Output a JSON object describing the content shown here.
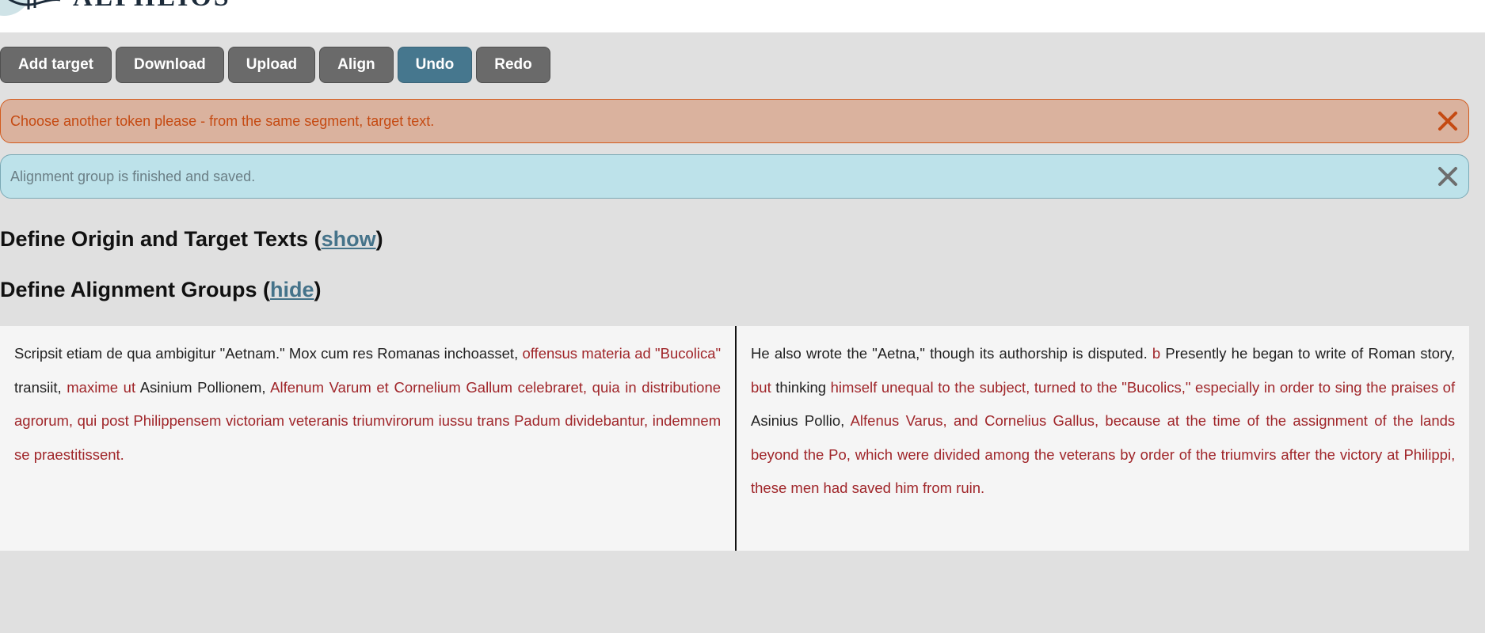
{
  "logo": {
    "text": "ALPHEIOS"
  },
  "toolbar": {
    "buttons": [
      {
        "label": "Add target",
        "active": false
      },
      {
        "label": "Download",
        "active": false
      },
      {
        "label": "Upload",
        "active": false
      },
      {
        "label": "Align",
        "active": false
      },
      {
        "label": "Undo",
        "active": true
      },
      {
        "label": "Redo",
        "active": false
      }
    ]
  },
  "alerts": {
    "error": {
      "text": "Choose another token please - from the same segment, target text.",
      "color": "#c54a12"
    },
    "info": {
      "text": "Alignment group is finished and saved."
    }
  },
  "sections": {
    "origin_target": {
      "title": "Define Origin and Target Texts (",
      "link": "show",
      "close": ")"
    },
    "alignment_groups": {
      "title": "Define Alignment Groups (",
      "link": "hide",
      "close": ")"
    }
  },
  "colors": {
    "aligned_token": "#a0262a",
    "active_button": "#46778e",
    "default_button": "#6a6a6a"
  },
  "origin_tokens": [
    {
      "t": "Scripsit",
      "a": false
    },
    {
      "t": "etiam",
      "a": false
    },
    {
      "t": "de",
      "a": false
    },
    {
      "t": "qua",
      "a": false
    },
    {
      "t": "ambigitur",
      "a": false
    },
    {
      "t": "\"Aetnam.\"",
      "a": false
    },
    {
      "t": "Mox",
      "a": false
    },
    {
      "t": "cum",
      "a": false
    },
    {
      "t": "res",
      "a": false
    },
    {
      "t": "Romanas",
      "a": false
    },
    {
      "t": "inchoasset,",
      "a": false
    },
    {
      "t": "offensus",
      "a": true
    },
    {
      "t": "materia",
      "a": true
    },
    {
      "t": "ad",
      "a": true
    },
    {
      "t": "\"Bucolica\"",
      "a": true
    },
    {
      "t": "transiit,",
      "a": false
    },
    {
      "t": "maxime",
      "a": true
    },
    {
      "t": "ut",
      "a": true
    },
    {
      "t": "Asinium",
      "a": false
    },
    {
      "t": "Pollionem,",
      "a": false
    },
    {
      "t": "Alfenum",
      "a": true
    },
    {
      "t": "Varum",
      "a": true
    },
    {
      "t": "et",
      "a": true
    },
    {
      "t": "Cornelium",
      "a": true
    },
    {
      "t": "Gallum",
      "a": true
    },
    {
      "t": "celebraret,",
      "a": true
    },
    {
      "t": "quia",
      "a": true
    },
    {
      "t": "in",
      "a": true
    },
    {
      "t": "distributione",
      "a": true
    },
    {
      "t": "agrorum,",
      "a": true
    },
    {
      "t": "qui",
      "a": true
    },
    {
      "t": "post",
      "a": true
    },
    {
      "t": "Philippensem",
      "a": true
    },
    {
      "t": "victoriam",
      "a": true
    },
    {
      "t": "veteranis",
      "a": true
    },
    {
      "t": "triumvirorum",
      "a": true
    },
    {
      "t": "iussu",
      "a": true
    },
    {
      "t": "trans",
      "a": true
    },
    {
      "t": "Padum",
      "a": true
    },
    {
      "t": "dividebantur,",
      "a": true
    },
    {
      "t": "indemnem",
      "a": true
    },
    {
      "t": "se",
      "a": true
    },
    {
      "t": "praestitissent.",
      "a": true
    }
  ],
  "target_tokens": [
    {
      "t": "He",
      "a": false
    },
    {
      "t": "also",
      "a": false
    },
    {
      "t": "wrote",
      "a": false
    },
    {
      "t": "the",
      "a": false
    },
    {
      "t": "\"Aetna,\"",
      "a": false
    },
    {
      "t": "though",
      "a": false
    },
    {
      "t": "its",
      "a": false
    },
    {
      "t": "authorship",
      "a": false
    },
    {
      "t": "is",
      "a": false
    },
    {
      "t": "disputed.",
      "a": false
    },
    {
      "t": "b",
      "a": true
    },
    {
      "t": "Presently",
      "a": false
    },
    {
      "t": "he",
      "a": false
    },
    {
      "t": "began",
      "a": false
    },
    {
      "t": "to",
      "a": false
    },
    {
      "t": "write",
      "a": false
    },
    {
      "t": "of",
      "a": false
    },
    {
      "t": "Roman",
      "a": false
    },
    {
      "t": "story,",
      "a": false
    },
    {
      "t": "but",
      "a": true
    },
    {
      "t": "thinking",
      "a": false
    },
    {
      "t": "himself",
      "a": true
    },
    {
      "t": "unequal",
      "a": true
    },
    {
      "t": "to",
      "a": true
    },
    {
      "t": "the",
      "a": true
    },
    {
      "t": "subject,",
      "a": true
    },
    {
      "t": "turned",
      "a": true
    },
    {
      "t": "to",
      "a": true
    },
    {
      "t": "the",
      "a": true
    },
    {
      "t": "\"Bucolics,\"",
      "a": true
    },
    {
      "t": "especially",
      "a": true
    },
    {
      "t": "in",
      "a": true
    },
    {
      "t": "order",
      "a": true
    },
    {
      "t": "to",
      "a": true
    },
    {
      "t": "sing",
      "a": true
    },
    {
      "t": "the",
      "a": true
    },
    {
      "t": "praises",
      "a": true
    },
    {
      "t": "of",
      "a": true
    },
    {
      "t": "Asinius",
      "a": false
    },
    {
      "t": "Pollio,",
      "a": false
    },
    {
      "t": "Alfenus",
      "a": true
    },
    {
      "t": "Varus,",
      "a": true
    },
    {
      "t": "and",
      "a": true
    },
    {
      "t": "Cornelius",
      "a": true
    },
    {
      "t": "Gallus,",
      "a": true
    },
    {
      "t": "because",
      "a": true
    },
    {
      "t": "at",
      "a": true
    },
    {
      "t": "the",
      "a": true
    },
    {
      "t": "time",
      "a": true
    },
    {
      "t": "of",
      "a": true
    },
    {
      "t": "the",
      "a": true
    },
    {
      "t": "assignment",
      "a": true
    },
    {
      "t": "of",
      "a": true
    },
    {
      "t": "the",
      "a": true
    },
    {
      "t": "lands",
      "a": true
    },
    {
      "t": "beyond",
      "a": true
    },
    {
      "t": "the",
      "a": true
    },
    {
      "t": "Po,",
      "a": true
    },
    {
      "t": "which",
      "a": true
    },
    {
      "t": "were",
      "a": true
    },
    {
      "t": "divided",
      "a": true
    },
    {
      "t": "among",
      "a": true
    },
    {
      "t": "the",
      "a": true
    },
    {
      "t": "veterans",
      "a": true
    },
    {
      "t": "by",
      "a": true
    },
    {
      "t": "order",
      "a": true
    },
    {
      "t": "of",
      "a": true
    },
    {
      "t": "the",
      "a": true
    },
    {
      "t": "triumvirs",
      "a": true
    },
    {
      "t": "after",
      "a": true
    },
    {
      "t": "the",
      "a": true
    },
    {
      "t": "victory",
      "a": true
    },
    {
      "t": "at",
      "a": true
    },
    {
      "t": "Philippi,",
      "a": true
    },
    {
      "t": "these",
      "a": true
    },
    {
      "t": "men",
      "a": true
    },
    {
      "t": "had",
      "a": true
    },
    {
      "t": "saved",
      "a": true
    },
    {
      "t": "him",
      "a": true
    },
    {
      "t": "from",
      "a": true
    },
    {
      "t": "ruin.",
      "a": true
    }
  ]
}
